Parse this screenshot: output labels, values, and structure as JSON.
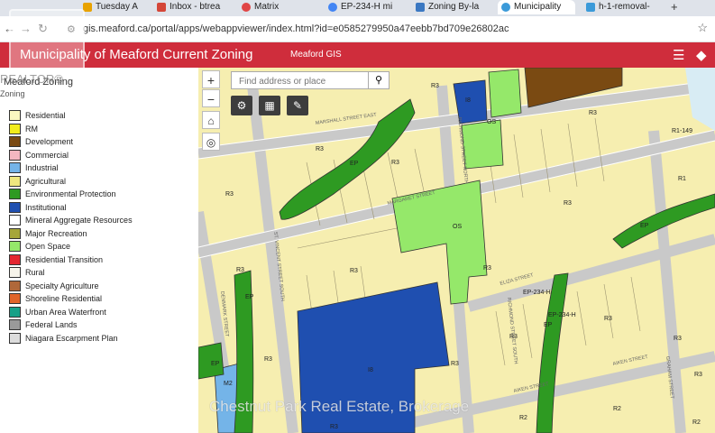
{
  "browser": {
    "tabs": [
      {
        "label": "Tuesday A",
        "color": "#e8a200"
      },
      {
        "label": "Inbox - btrea",
        "color": "#d44638"
      },
      {
        "label": "Matrix",
        "color": "#e04545"
      },
      {
        "label": "EP-234-H mi",
        "color": "#4285f4"
      },
      {
        "label": "Zoning By-la",
        "color": "#3b78c2"
      },
      {
        "label": "Municipality",
        "color": "#3b9ad9"
      },
      {
        "label": "h-1-removal-",
        "color": "#3b9ad9"
      }
    ],
    "new_tab": "+",
    "url": "gis.meaford.ca/portal/apps/webappviewer/index.html?id=e0585279950a47eebb7bd709e26802ac"
  },
  "app": {
    "title": "Municipality of Meaford Current Zoning",
    "subtitle": "Meaford GIS"
  },
  "legend": {
    "title": "Meaford Zoning",
    "subtitle": "Zoning",
    "items": [
      {
        "label": "Residential",
        "color": "#fbf7c0"
      },
      {
        "label": "RM",
        "color": "#f2ec1b"
      },
      {
        "label": "Development",
        "color": "#7a4a12"
      },
      {
        "label": "Commercial",
        "color": "#f3b6c0"
      },
      {
        "label": "Industrial",
        "color": "#74b4e8"
      },
      {
        "label": "Agricultural",
        "color": "#efe77f"
      },
      {
        "label": "Environmental Protection",
        "color": "#2e9a22"
      },
      {
        "label": "Institutional",
        "color": "#1f4fb0"
      },
      {
        "label": "Mineral Aggregate Resources",
        "color": "#ffffff"
      },
      {
        "label": "Major Recreation",
        "color": "#a6a63a"
      },
      {
        "label": "Open Space",
        "color": "#95e86a"
      },
      {
        "label": "Residential Transition",
        "color": "#e3262f"
      },
      {
        "label": "Rural",
        "color": "#f7f4ea"
      },
      {
        "label": "Specialty Agriculture",
        "color": "#b0683a"
      },
      {
        "label": "Shoreline Residential",
        "color": "#e0642a"
      },
      {
        "label": "Urban Area Waterfront",
        "color": "#17a087"
      },
      {
        "label": "Federal Lands",
        "color": "#9a9a9a"
      },
      {
        "label": "Niagara Escarpment Plan",
        "color": "#dcdcdc"
      }
    ]
  },
  "map": {
    "search_placeholder": "Find address or place",
    "streets": [
      "MARSHALL STREET EAST",
      "RICHMOND STREET NORTH",
      "MARGARET STREET",
      "ST. VINCENT STREET SOUTH",
      "ELIZA STREET",
      "RICHMOND STREET SOUTH",
      "AIKEN STREET",
      "DENMARK STREET",
      "GRAHAM STREET",
      "AIKEN STREET"
    ],
    "zone_labels": [
      "R3",
      "I8",
      "OS",
      "R3",
      "R1-149",
      "EP",
      "R3",
      "R3",
      "R3",
      "R1",
      "OS",
      "R3",
      "EP",
      "R3",
      "R3",
      "EP",
      "R3",
      "EP-234-H",
      "EP-234-H",
      "R3",
      "R3",
      "EP",
      "R3",
      "I8",
      "R3",
      "R3",
      "EP",
      "M2",
      "R3",
      "R2",
      "R2",
      "R3",
      "R2"
    ]
  },
  "watermark": "Chestnut Park Real Estate, Brokerage",
  "realtor": "REALTOR®"
}
